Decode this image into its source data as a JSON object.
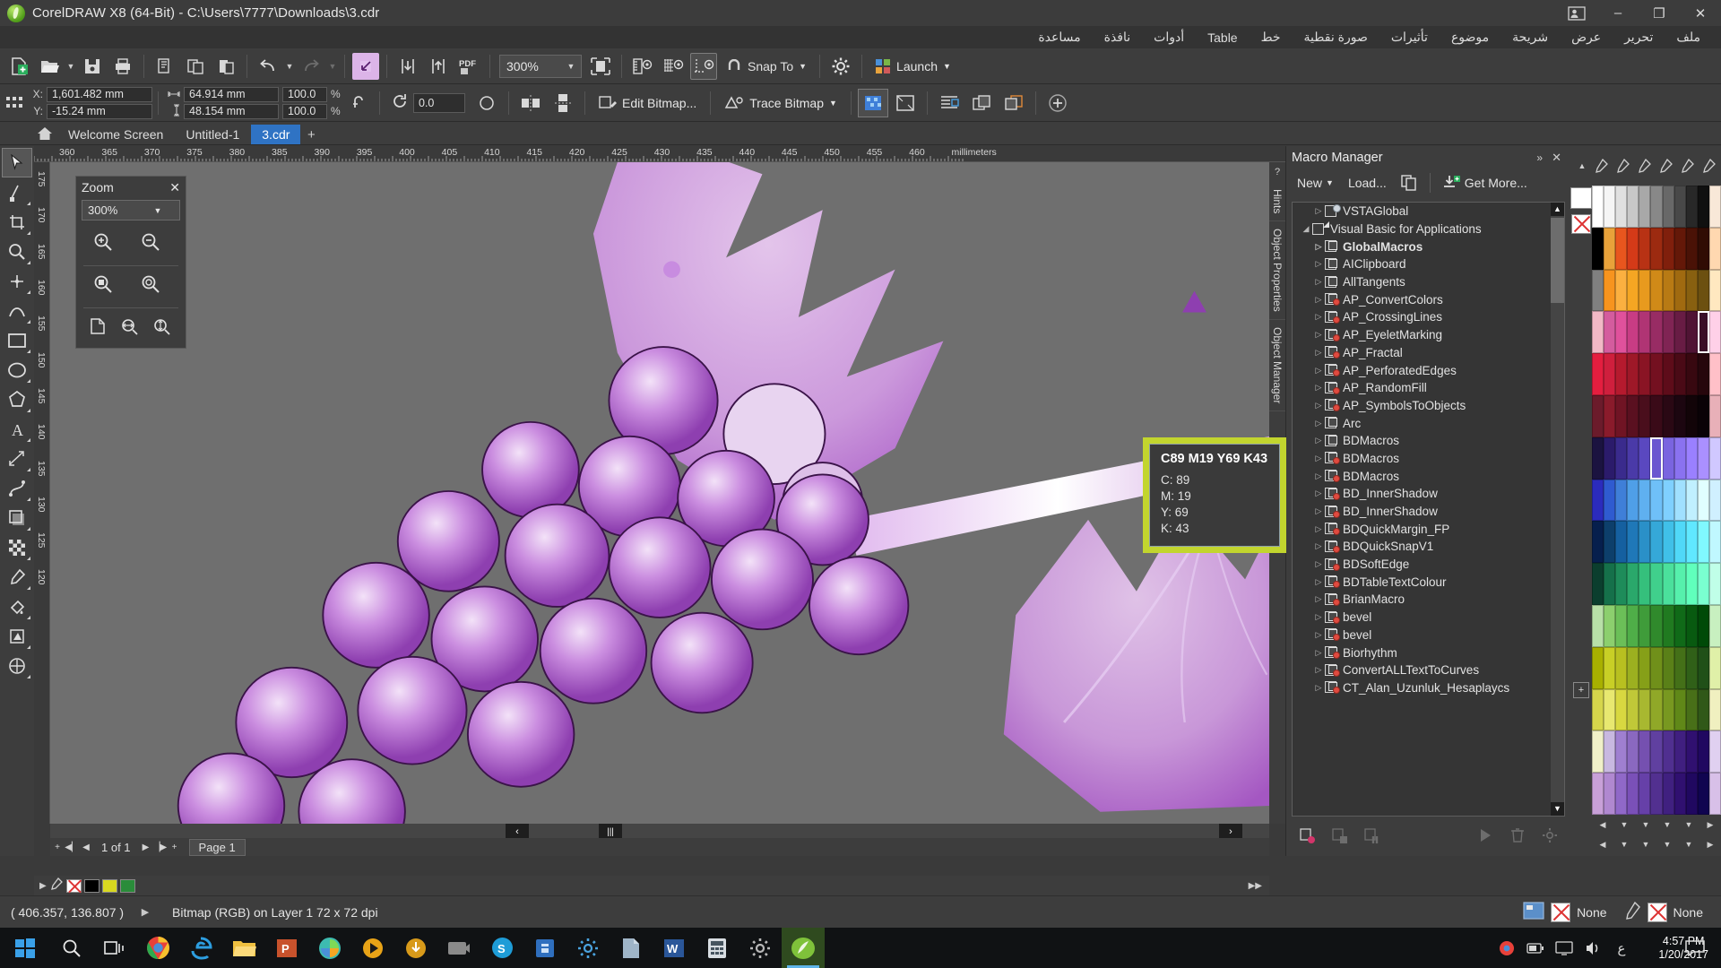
{
  "window": {
    "title": "CorelDRAW X8 (64-Bit) - C:\\Users\\7777\\Downloads\\3.cdr",
    "minimize": "–",
    "maximize": "❐",
    "close": "✕",
    "user_icon": "user-account-icon"
  },
  "menu": {
    "items": [
      {
        "label": "ملف",
        "name": "file"
      },
      {
        "label": "تحرير",
        "name": "edit"
      },
      {
        "label": "عرض",
        "name": "view"
      },
      {
        "label": "شريحة",
        "name": "layout"
      },
      {
        "label": "موضوع",
        "name": "object"
      },
      {
        "label": "تأثيرات",
        "name": "effects"
      },
      {
        "label": "صورة نقطية",
        "name": "bitmaps"
      },
      {
        "label": "خط",
        "name": "text"
      },
      {
        "label": "Table",
        "name": "table"
      },
      {
        "label": "أدوات",
        "name": "tools"
      },
      {
        "label": "نافذة",
        "name": "window"
      },
      {
        "label": "مساعدة",
        "name": "help"
      }
    ]
  },
  "toolbar": {
    "zoom_level": "300%",
    "snap_to": "Snap To",
    "launch": "Launch",
    "icons": [
      "new-document-icon",
      "open-icon",
      "save-icon",
      "print-icon",
      "cut-icon",
      "copy-icon",
      "paste-icon",
      "undo-icon",
      "redo-icon",
      "publish-icon",
      "import-icon",
      "export-icon",
      "export-pdf-icon",
      "zoom-level-combo",
      "full-screen-preview-icon",
      "show-rulers-icon",
      "show-grid-icon",
      "show-guidelines-icon",
      "options-icon"
    ]
  },
  "propertybar": {
    "x_label": "X:",
    "x_value": "1,601.482 mm",
    "y_label": "Y:",
    "y_value": "-15.24 mm",
    "width_value": "64.914 mm",
    "height_value": "48.154 mm",
    "scale_w": "100.0",
    "scale_h": "100.0",
    "percent": "%",
    "rotation": "0.0",
    "edit_bitmap": "Edit Bitmap...",
    "trace_bitmap": "Trace Bitmap"
  },
  "tabs": {
    "items": [
      {
        "label": "Welcome Screen",
        "active": false
      },
      {
        "label": "Untitled-1",
        "active": false
      },
      {
        "label": "3.cdr",
        "active": true
      }
    ],
    "add": "+"
  },
  "toolbox": {
    "tools": [
      {
        "name": "pick-tool",
        "glyph": "➤",
        "active": true
      },
      {
        "name": "shape-tool",
        "glyph": "✒"
      },
      {
        "name": "crop-tool",
        "glyph": "✄"
      },
      {
        "name": "zoom-tool",
        "glyph": "⌕"
      },
      {
        "name": "freehand-tool",
        "glyph": "✎"
      },
      {
        "name": "artistic-media-tool",
        "glyph": "⤳"
      },
      {
        "name": "rectangle-tool",
        "glyph": "▭"
      },
      {
        "name": "ellipse-tool",
        "glyph": "◯"
      },
      {
        "name": "polygon-tool",
        "glyph": "⬠"
      },
      {
        "name": "text-tool",
        "glyph": "A"
      },
      {
        "name": "parallel-dimension-tool",
        "glyph": "⤡"
      },
      {
        "name": "straight-line-connector-tool",
        "glyph": "⟋"
      },
      {
        "name": "drop-shadow-tool",
        "glyph": "◰"
      },
      {
        "name": "transparency-tool",
        "glyph": "▦"
      },
      {
        "name": "color-eyedropper-tool",
        "glyph": "✐"
      },
      {
        "name": "interactive-fill-tool",
        "glyph": "◢"
      },
      {
        "name": "smart-fill-tool",
        "glyph": "⬟"
      },
      {
        "name": "outline-tool",
        "glyph": "⊕"
      }
    ]
  },
  "ruler": {
    "unit": "millimeters",
    "h_ticks": [
      "360",
      "365",
      "370",
      "375",
      "380",
      "385",
      "390",
      "395",
      "400",
      "405",
      "410",
      "415",
      "420",
      "425",
      "430",
      "435",
      "440",
      "445",
      "450",
      "455",
      "460"
    ],
    "v_ticks": [
      "175",
      "170",
      "165",
      "160",
      "155",
      "150",
      "145",
      "140",
      "135",
      "130",
      "125",
      "120"
    ]
  },
  "zoom_panel": {
    "title": "Zoom",
    "close": "✕",
    "value": "300%",
    "buttons": [
      "zoom-in-icon",
      "zoom-out-icon",
      "zoom-to-selected-icon",
      "zoom-to-all-objects-icon",
      "zoom-to-page-icon",
      "zoom-to-page-width-icon",
      "zoom-to-page-height-icon"
    ]
  },
  "pagebar": {
    "page_counter": "1 of 1",
    "page_tab": "Page 1",
    "first": "◀▏",
    "prev": "◀",
    "next": "▶",
    "last": "▕▶",
    "add_page": "+"
  },
  "docker": {
    "title": "Macro Manager",
    "collapse": "»",
    "close": "✕",
    "new_label": "New",
    "load_label": "Load...",
    "get_more_label": "Get More...",
    "items": [
      {
        "label": "VSTAGlobal",
        "indent": 1,
        "icon": "global-macro-icon",
        "bold": false
      },
      {
        "label": "Visual Basic for Applications",
        "indent": 0,
        "icon": "vba-project-icon",
        "bold": false,
        "expanded": true
      },
      {
        "label": "GlobalMacros",
        "indent": 1,
        "icon": "macro-project-icon",
        "bold": true
      },
      {
        "label": "AIClipboard",
        "indent": 1,
        "icon": "macro-project-icon",
        "bold": false
      },
      {
        "label": "AllTangents",
        "indent": 1,
        "icon": "macro-project-icon",
        "bold": false
      },
      {
        "label": "AP_ConvertColors",
        "indent": 1,
        "icon": "macro-locked-icon",
        "bold": false
      },
      {
        "label": "AP_CrossingLines",
        "indent": 1,
        "icon": "macro-locked-icon",
        "bold": false
      },
      {
        "label": "AP_EyeletMarking",
        "indent": 1,
        "icon": "macro-locked-icon",
        "bold": false
      },
      {
        "label": "AP_Fractal",
        "indent": 1,
        "icon": "macro-locked-icon",
        "bold": false
      },
      {
        "label": "AP_PerforatedEdges",
        "indent": 1,
        "icon": "macro-locked-icon",
        "bold": false
      },
      {
        "label": "AP_RandomFill",
        "indent": 1,
        "icon": "macro-locked-icon",
        "bold": false
      },
      {
        "label": "AP_SymbolsToObjects",
        "indent": 1,
        "icon": "macro-locked-icon",
        "bold": false
      },
      {
        "label": "Arc",
        "indent": 1,
        "icon": "macro-project-icon",
        "bold": false
      },
      {
        "label": "BDMacros",
        "indent": 1,
        "icon": "macro-project-icon",
        "bold": false
      },
      {
        "label": "BDMacros",
        "indent": 1,
        "icon": "macro-locked-icon",
        "bold": false
      },
      {
        "label": "BDMacros",
        "indent": 1,
        "icon": "macro-locked-icon",
        "bold": false
      },
      {
        "label": "BD_InnerShadow",
        "indent": 1,
        "icon": "macro-locked-icon",
        "bold": false
      },
      {
        "label": "BD_InnerShadow",
        "indent": 1,
        "icon": "macro-locked-icon",
        "bold": false
      },
      {
        "label": "BDQuickMargin_FP",
        "indent": 1,
        "icon": "macro-locked-icon",
        "bold": false
      },
      {
        "label": "BDQuickSnapV1",
        "indent": 1,
        "icon": "macro-locked-icon",
        "bold": false
      },
      {
        "label": "BDSoftEdge",
        "indent": 1,
        "icon": "macro-locked-icon",
        "bold": false
      },
      {
        "label": "BDTableTextColour",
        "indent": 1,
        "icon": "macro-locked-icon",
        "bold": false
      },
      {
        "label": "BrianMacro",
        "indent": 1,
        "icon": "macro-locked-icon",
        "bold": false
      },
      {
        "label": "bevel",
        "indent": 1,
        "icon": "macro-locked-icon",
        "bold": false
      },
      {
        "label": "bevel",
        "indent": 1,
        "icon": "macro-locked-icon",
        "bold": false
      },
      {
        "label": "Biorhythm",
        "indent": 1,
        "icon": "macro-locked-icon",
        "bold": false
      },
      {
        "label": "ConvertALLTextToCurves",
        "indent": 1,
        "icon": "macro-locked-icon",
        "bold": false
      },
      {
        "label": "CT_Alan_Uzunluk_Hesaplaycs",
        "indent": 1,
        "icon": "macro-locked-icon",
        "bold": false
      }
    ]
  },
  "color_tooltip": {
    "title": "C89 M19 Y69 K43",
    "lines": [
      "C: 89",
      "M: 19",
      "Y: 69",
      "K: 43"
    ],
    "border_color": "#c2d52e",
    "swatch_color": "#1e5c44"
  },
  "side_dock_tabs": [
    "Hints",
    "Object Properties",
    "Object Manager"
  ],
  "statusbar": {
    "coordinates": "( 406.357, 136.807 )",
    "object_info": "Bitmap (RGB) on Layer 1 72 x 72 dpi",
    "fill_label": "None",
    "outline_label": "None"
  },
  "taskbar": {
    "time": "4:57 PM",
    "date": "1/20/2017",
    "apps": [
      "start-icon",
      "search-icon",
      "task-view-icon",
      "chrome-icon",
      "edge-icon",
      "file-explorer-icon",
      "powerpoint-icon",
      "photo-viewer-icon",
      "media-icon",
      "download-icon",
      "camera-icon",
      "skype-icon",
      "store-icon",
      "settings-gear-icon",
      "file-app-icon",
      "word-icon",
      "calculator-icon",
      "control-panel-icon",
      "coreldraw-icon"
    ],
    "tray": [
      "chrome-tray-icon",
      "battery-icon",
      "display-icon",
      "volume-icon",
      "ime-icon"
    ],
    "notification": "notification-icon"
  },
  "palette": {
    "selected_index": 0,
    "columns": [
      [
        "#ffffff",
        "#000000",
        "#808080",
        "#f2b8c6",
        "#e41e3f",
        "#6b1b2b",
        "#1b1340",
        "#2b2bbd",
        "#061f4d",
        "#0b3e2e",
        "#b8e0a8",
        "#a8b000",
        "#d6d64b",
        "#f0f0c8",
        "#c8a0d8"
      ],
      [
        "#f5f5f5",
        "#e8a23a",
        "#f7941e",
        "#d45c9e",
        "#cf1f3d",
        "#8a1b2b",
        "#2b1b6b",
        "#2f5bd0",
        "#0d3f6b",
        "#15704a",
        "#8ccf6e",
        "#c8cf26",
        "#e8e870",
        "#c8b8e0",
        "#b088d0"
      ],
      [
        "#e0e0e0",
        "#e8561e",
        "#fbb040",
        "#e0519c",
        "#b51a2e",
        "#701424",
        "#3a2b8d",
        "#3f7fd8",
        "#1560a0",
        "#1e8c5a",
        "#6bbf58",
        "#b8c020",
        "#d8d840",
        "#9f7fd0",
        "#9068c8"
      ],
      [
        "#c8c8c8",
        "#d43a18",
        "#f5a623",
        "#c83c84",
        "#9e1828",
        "#5a1020",
        "#4a3aa8",
        "#4f9fe8",
        "#1f78b8",
        "#2aa86b",
        "#4fae48",
        "#9cb020",
        "#c0c838",
        "#8a68c0",
        "#7a50b8"
      ],
      [
        "#a8a8a8",
        "#b83214",
        "#e89a1e",
        "#b03474",
        "#8a1424",
        "#4a0e1c",
        "#5a48c0",
        "#5fb0f0",
        "#2a90c8",
        "#35c07c",
        "#3f9c3a",
        "#86a018",
        "#a8b830",
        "#7550b0",
        "#6640a8"
      ],
      [
        "#888888",
        "#9c2a10",
        "#d08a18",
        "#982c64",
        "#741020",
        "#3a0a18",
        "#6a56d0",
        "#6fc0f8",
        "#35a8d8",
        "#40d08c",
        "#308a2c",
        "#70901a",
        "#90a828",
        "#6040a0",
        "#523090"
      ],
      [
        "#686868",
        "#801f0c",
        "#b87a14",
        "#802454",
        "#5e0c1a",
        "#2a0814",
        "#7a64e0",
        "#7fd0ff",
        "#40c0e8",
        "#4be09c",
        "#207a20",
        "#5a8018",
        "#789820",
        "#502f90",
        "#402080"
      ],
      [
        "#484848",
        "#641808",
        "#a06a10",
        "#681c44",
        "#4a0a16",
        "#1c0610",
        "#8a72f0",
        "#a0e0ff",
        "#50d8f8",
        "#56f0ac",
        "#106a18",
        "#447018",
        "#608818",
        "#401f80",
        "#301070"
      ],
      [
        "#282828",
        "#4a1206",
        "#886010",
        "#501434",
        "#380810",
        "#120408",
        "#9a80ff",
        "#c0f0ff",
        "#60e8ff",
        "#60ffbc",
        "#085a10",
        "#306018",
        "#486f18",
        "#301070",
        "#200860"
      ],
      [
        "#101010",
        "#300c04",
        "#6c5010",
        "#3a0f28",
        "#26060c",
        "#0a0206",
        "#aa90ff",
        "#e0ffff",
        "#80f8ff",
        "#7affd0",
        "#004a08",
        "#205018",
        "#305818",
        "#200860",
        "#100450"
      ],
      [
        "#f8e8d8",
        "#ffd8b0",
        "#ffe8c0",
        "#ffd0e8",
        "#ffc0c8",
        "#e8b0b8",
        "#d0c8ff",
        "#d0f0ff",
        "#c0f8ff",
        "#c0ffe8",
        "#c8f0c0",
        "#e0f0a8",
        "#f0f0c0",
        "#e0d0f0",
        "#d8c0e8"
      ]
    ]
  }
}
